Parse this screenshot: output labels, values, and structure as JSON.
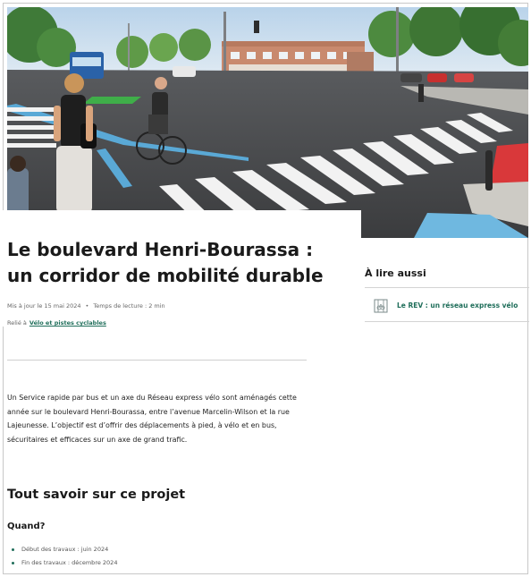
{
  "article": {
    "title": "Le boulevard Henri-Bourassa : un corridor de mobilité durable",
    "updated": "Mis à jour le 15 mai 2024",
    "reading_time": "Temps de lecture : 2 min",
    "related_prefix": "Relié à",
    "related_link": "Vélo et pistes cyclables",
    "intro": "Un Service rapide par bus et un axe du Réseau express vélo sont aménagés cette année sur le boulevard Henri-Bourassa, entre l’avenue Marcelin-Wilson et la rue Lajeunesse. L’objectif est d’offrir des déplacements à pied, à vélo et en bus, sécuritaires et efficaces sur un axe de grand trafic.",
    "section_title": "Tout savoir sur ce projet",
    "when_title": "Quand?",
    "when_items": [
      "Début des travaux : juin 2024",
      "Fin des travaux : décembre 2024"
    ]
  },
  "aside": {
    "title": "À lire aussi",
    "items": [
      {
        "label": "Le REV : un réseau express vélo",
        "icon": "bike-lane-icon"
      }
    ]
  },
  "colors": {
    "link_green": "#1f6e5a",
    "bike_lane_green": "#3fae49",
    "bus_lane_red": "#d9383a",
    "accent_blue": "#5aa9d6"
  }
}
